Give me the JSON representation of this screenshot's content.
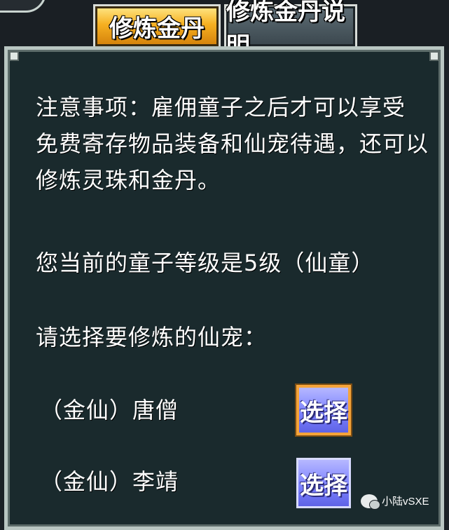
{
  "tabs": [
    {
      "label": "修炼金丹"
    },
    {
      "label": "修炼金丹说明"
    }
  ],
  "notice": {
    "lines": [
      "注意事项：雇佣童子之后才可以享受",
      "免费寄存物品装备和仙宠待遇，还可以",
      "修炼灵珠和金丹。"
    ]
  },
  "level_text": "您当前的童子等级是5级（仙童）",
  "prompt": "请选择要修炼的仙宠：",
  "pets": [
    {
      "name": "（金仙）唐僧",
      "button": "选择"
    },
    {
      "name": "（金仙）李靖",
      "button": "选择"
    }
  ],
  "watermark": "小陆vSXE"
}
